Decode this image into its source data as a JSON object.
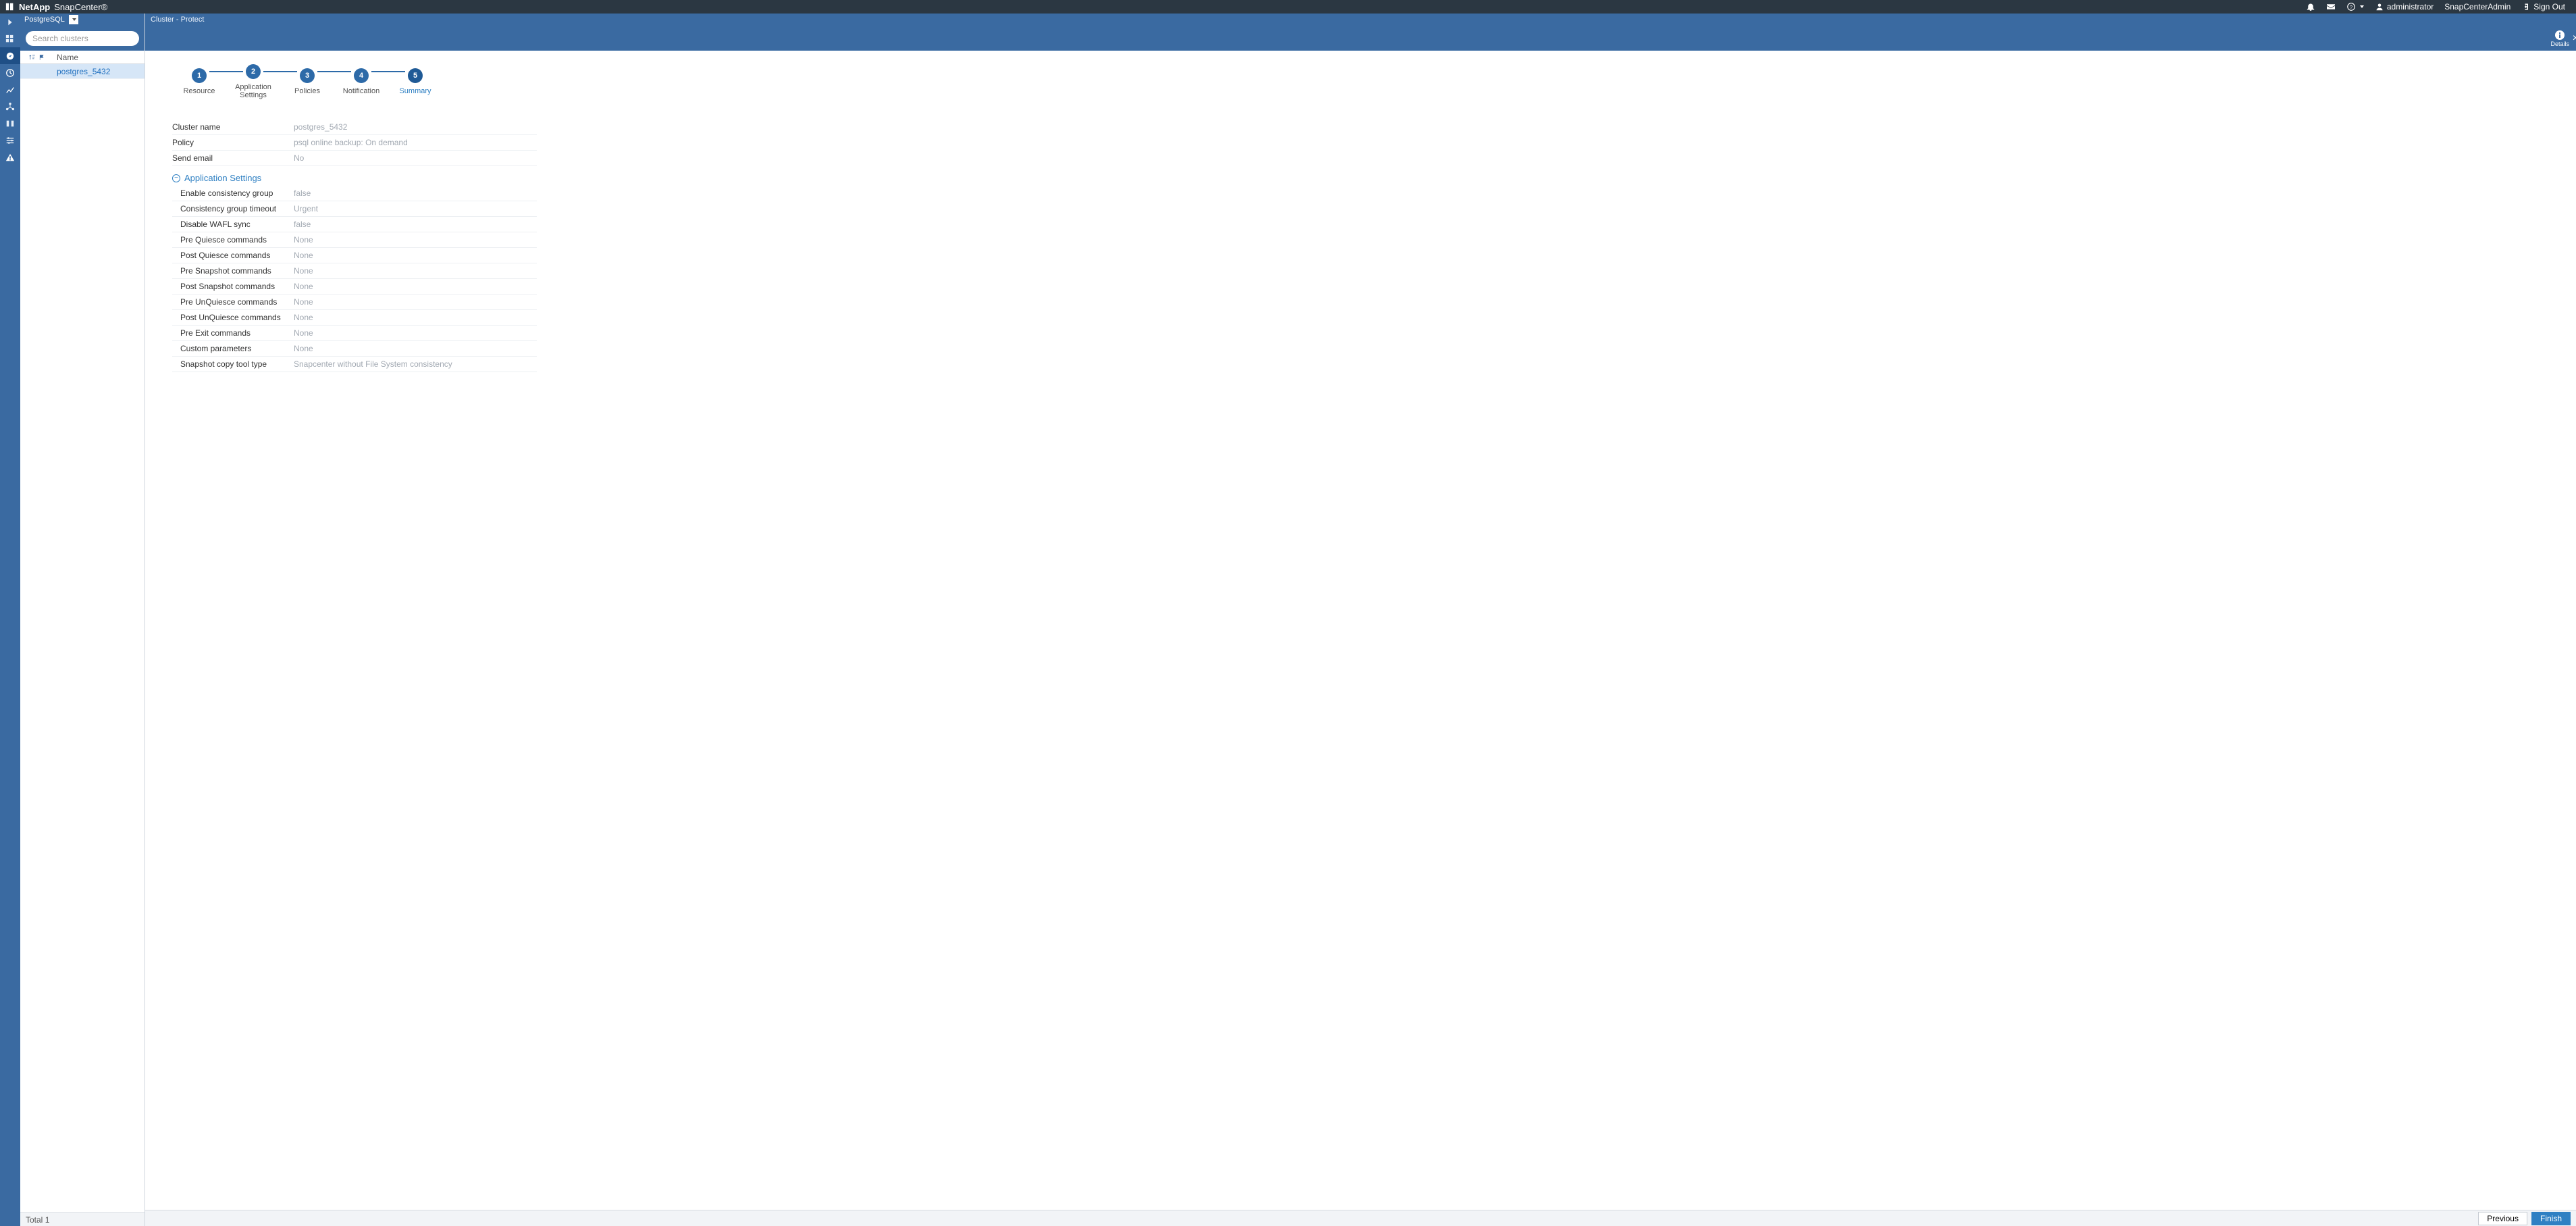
{
  "brand": {
    "vendor": "NetApp",
    "product": "SnapCenter®"
  },
  "topbar": {
    "user": "administrator",
    "role": "SnapCenterAdmin",
    "signout": "Sign Out"
  },
  "rail": {
    "items": [
      {
        "name": "collapse-toggle"
      },
      {
        "name": "dashboard-icon"
      },
      {
        "name": "resources-icon",
        "selected": true
      },
      {
        "name": "monitor-icon"
      },
      {
        "name": "reports-icon"
      },
      {
        "name": "hosts-icon"
      },
      {
        "name": "storage-icon"
      },
      {
        "name": "settings-icon"
      },
      {
        "name": "alerts-icon"
      }
    ]
  },
  "respanel": {
    "plugin_label": "PostgreSQL",
    "search_placeholder": "Search clusters",
    "header_name": "Name",
    "rows": [
      {
        "name": "postgres_5432",
        "selected": true
      }
    ],
    "footer_label": "Total",
    "footer_count": "1"
  },
  "breadcrumb": "Cluster - Protect",
  "details_label": "Details",
  "wizard": [
    {
      "n": "1",
      "label": "Resource"
    },
    {
      "n": "2",
      "label": "Application Settings"
    },
    {
      "n": "3",
      "label": "Policies"
    },
    {
      "n": "4",
      "label": "Notification"
    },
    {
      "n": "5",
      "label": "Summary",
      "current": true
    }
  ],
  "summary": {
    "rows": [
      {
        "label": "Cluster name",
        "value": "postgres_5432"
      },
      {
        "label": "Policy",
        "value": "psql online backup: On demand"
      },
      {
        "label": "Send email",
        "value": "No"
      }
    ],
    "appsettings": {
      "title": "Application Settings",
      "rows": [
        {
          "label": "Enable consistency group",
          "value": "false"
        },
        {
          "label": "Consistency group timeout",
          "value": "Urgent"
        },
        {
          "label": "Disable WAFL sync",
          "value": "false"
        },
        {
          "label": "Pre Quiesce commands",
          "value": "None"
        },
        {
          "label": "Post Quiesce commands",
          "value": "None"
        },
        {
          "label": "Pre Snapshot commands",
          "value": "None"
        },
        {
          "label": "Post Snapshot commands",
          "value": "None"
        },
        {
          "label": "Pre UnQuiesce commands",
          "value": "None"
        },
        {
          "label": "Post UnQuiesce commands",
          "value": "None"
        },
        {
          "label": "Pre Exit commands",
          "value": "None"
        },
        {
          "label": "Custom parameters",
          "value": "None"
        },
        {
          "label": "Snapshot copy tool type",
          "value": "Snapcenter without File System consistency"
        }
      ]
    }
  },
  "buttons": {
    "previous": "Previous",
    "finish": "Finish"
  }
}
